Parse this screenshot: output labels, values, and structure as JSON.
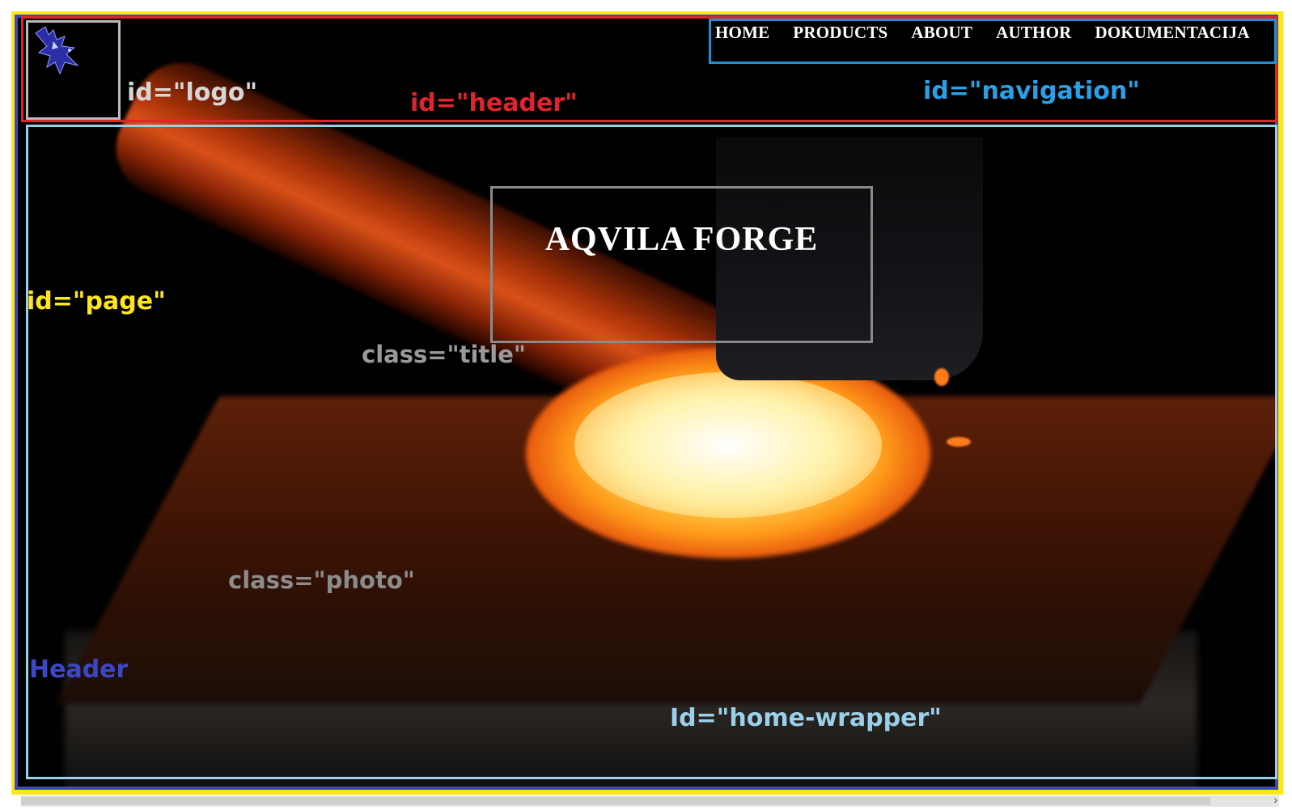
{
  "annotations": {
    "logo": "id=\"logo\"",
    "header": "id=\"header\"",
    "navigation": "id=\"navigation\"",
    "page": "id=\"page\"",
    "title": "class=\"title\"",
    "photo": "class=\"photo\"",
    "header_region": "Header",
    "home_wrapper": "Id=\"home-wrapper\""
  },
  "navigation": {
    "items": [
      "HOME",
      "PRODUCTS",
      "ABOUT",
      "AUTHOR",
      "DOKUMENTACIJA"
    ]
  },
  "title": "AQVILA FORGE",
  "logo": {
    "icon": "eagle-icon"
  },
  "colors": {
    "page_frame": "#ffe61a",
    "header_region_frame": "#3b47c9",
    "header_frame": "#e0242b",
    "navigation_frame": "#1e90d6",
    "home_wrapper_frame": "#9ad0ea",
    "logo_frame": "#b9b9b9",
    "title_frame": "#8a8a8a"
  }
}
